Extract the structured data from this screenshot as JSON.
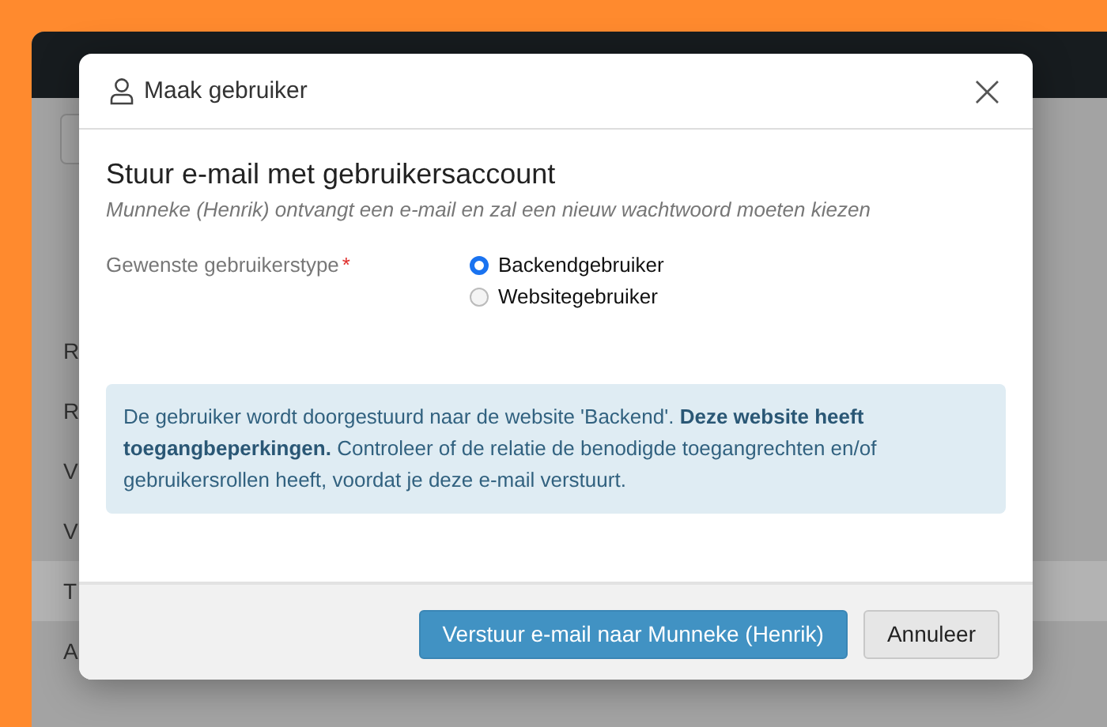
{
  "background": {
    "rows": [
      {
        "text": "R",
        "selected": false
      },
      {
        "text": "R",
        "selected": false
      },
      {
        "text": "V",
        "selected": false
      },
      {
        "text": "V",
        "selected": false
      },
      {
        "text": "T",
        "selected": true
      },
      {
        "text": "A",
        "selected": false
      }
    ]
  },
  "dialog": {
    "title": "Maak gebruiker",
    "close": "×",
    "heading": "Stuur e-mail met gebruikersaccount",
    "subtitle": "Munneke (Henrik) ontvangt een e-mail en zal een nieuw wachtwoord moeten kiezen",
    "field": {
      "label": "Gewenste gebruikerstype",
      "required_mark": "*",
      "options": [
        {
          "label": "Backendgebruiker",
          "selected": true
        },
        {
          "label": "Websitegebruiker",
          "selected": false
        }
      ]
    },
    "alert": "De gebruiker wordt doorgestuurd naar de website 'Backend'. **Deze website heeft toegangbeperkingen.** Controleer of de relatie de benodigde toegangrechten en/of gebruikersrollen heeft, voordat je deze e-mail verstuurt.",
    "buttons": [
      {
        "label": "Verstuur e-mail naar Munneke (Henrik)",
        "kind": "primary"
      },
      {
        "label": "Annuleer",
        "kind": "secondary"
      }
    ]
  }
}
